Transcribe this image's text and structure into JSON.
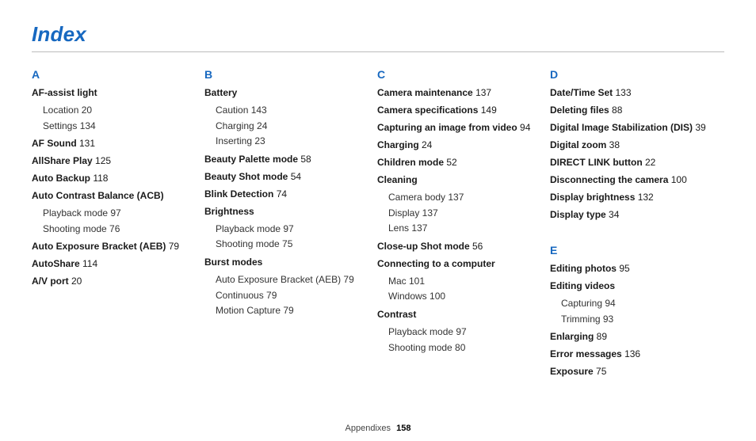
{
  "title": "Index",
  "footer": {
    "section": "Appendixes",
    "page": "158"
  },
  "cols": [
    {
      "blocks": [
        {
          "letter": "A",
          "entries": [
            {
              "text": "AF-assist light",
              "page": "",
              "subs": [
                {
                  "text": "Location",
                  "page": "20"
                },
                {
                  "text": "Settings",
                  "page": "134"
                }
              ]
            },
            {
              "text": "AF Sound",
              "page": "131"
            },
            {
              "text": "AllShare Play",
              "page": "125"
            },
            {
              "text": "Auto Backup",
              "page": "118"
            },
            {
              "text": "Auto Contrast Balance (ACB)",
              "page": "",
              "subs": [
                {
                  "text": "Playback mode",
                  "page": "97"
                },
                {
                  "text": "Shooting mode",
                  "page": "76"
                }
              ]
            },
            {
              "text": "Auto Exposure Bracket (AEB)",
              "page": "79"
            },
            {
              "text": "AutoShare",
              "page": "114"
            },
            {
              "text": "A/V port",
              "page": "20"
            }
          ]
        }
      ]
    },
    {
      "blocks": [
        {
          "letter": "B",
          "entries": [
            {
              "text": "Battery",
              "page": "",
              "subs": [
                {
                  "text": "Caution",
                  "page": "143"
                },
                {
                  "text": "Charging",
                  "page": "24"
                },
                {
                  "text": "Inserting",
                  "page": "23"
                }
              ]
            },
            {
              "text": "Beauty Palette mode",
              "page": "58"
            },
            {
              "text": "Beauty Shot mode",
              "page": "54"
            },
            {
              "text": "Blink Detection",
              "page": "74"
            },
            {
              "text": "Brightness",
              "page": "",
              "subs": [
                {
                  "text": "Playback mode",
                  "page": "97"
                },
                {
                  "text": "Shooting mode",
                  "page": "75"
                }
              ]
            },
            {
              "text": "Burst modes",
              "page": "",
              "subs": [
                {
                  "text": "Auto Exposure Bracket (AEB)",
                  "page": "79"
                },
                {
                  "text": "Continuous",
                  "page": "79"
                },
                {
                  "text": "Motion Capture",
                  "page": "79"
                }
              ]
            }
          ]
        }
      ]
    },
    {
      "blocks": [
        {
          "letter": "C",
          "entries": [
            {
              "text": "Camera maintenance",
              "page": "137"
            },
            {
              "text": "Camera specifications",
              "page": "149"
            },
            {
              "text": "Capturing an image from video",
              "page": "94"
            },
            {
              "text": "Charging",
              "page": "24"
            },
            {
              "text": "Children mode",
              "page": "52"
            },
            {
              "text": "Cleaning",
              "page": "",
              "subs": [
                {
                  "text": "Camera body",
                  "page": "137"
                },
                {
                  "text": "Display",
                  "page": "137"
                },
                {
                  "text": "Lens",
                  "page": "137"
                }
              ]
            },
            {
              "text": "Close-up Shot mode",
              "page": "56"
            },
            {
              "text": "Connecting to a computer",
              "page": "",
              "subs": [
                {
                  "text": "Mac",
                  "page": "101"
                },
                {
                  "text": "Windows",
                  "page": "100"
                }
              ]
            },
            {
              "text": "Contrast",
              "page": "",
              "subs": [
                {
                  "text": "Playback mode",
                  "page": "97"
                },
                {
                  "text": "Shooting mode",
                  "page": "80"
                }
              ]
            }
          ]
        }
      ]
    },
    {
      "blocks": [
        {
          "letter": "D",
          "entries": [
            {
              "text": "Date/Time Set",
              "page": "133"
            },
            {
              "text": "Deleting files",
              "page": "88"
            },
            {
              "text": "Digital Image Stabilization (DIS)",
              "page": "39"
            },
            {
              "text": "Digital zoom",
              "page": "38"
            },
            {
              "text": "DIRECT LINK button",
              "page": "22"
            },
            {
              "text": "Disconnecting the camera",
              "page": "100"
            },
            {
              "text": "Display brightness",
              "page": "132"
            },
            {
              "text": "Display type",
              "page": "34"
            }
          ]
        },
        {
          "letter": "E",
          "entries": [
            {
              "text": "Editing photos",
              "page": "95"
            },
            {
              "text": "Editing videos",
              "page": "",
              "subs": [
                {
                  "text": "Capturing",
                  "page": "94"
                },
                {
                  "text": "Trimming",
                  "page": "93"
                }
              ]
            },
            {
              "text": "Enlarging",
              "page": "89"
            },
            {
              "text": "Error messages",
              "page": "136"
            },
            {
              "text": "Exposure",
              "page": "75"
            }
          ]
        }
      ]
    }
  ]
}
